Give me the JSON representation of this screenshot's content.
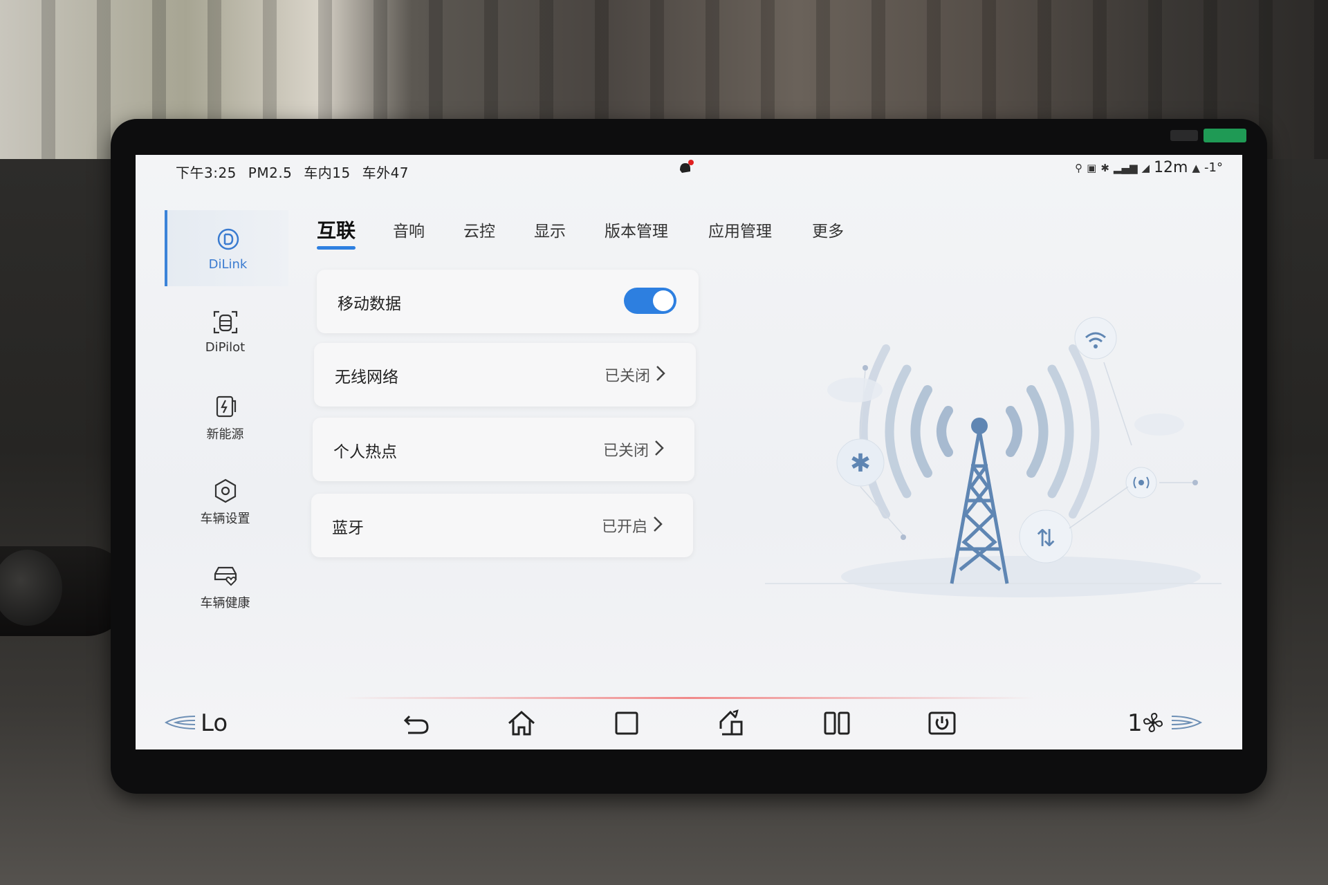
{
  "status_bar": {
    "time": "下午3:25",
    "pm25": "PM2.5",
    "indoor": "车内15",
    "outdoor": "车外47",
    "right_text": "12m",
    "right_temp": "-1°"
  },
  "sidebar": {
    "items": [
      {
        "label": "DiLink",
        "icon": "dilink-icon",
        "active": true
      },
      {
        "label": "DiPilot",
        "icon": "dipilot-icon",
        "active": false
      },
      {
        "label": "新能源",
        "icon": "charging-icon",
        "active": false
      },
      {
        "label": "车辆设置",
        "icon": "hexagon-settings-icon",
        "active": false
      },
      {
        "label": "车辆健康",
        "icon": "car-health-icon",
        "active": false
      }
    ]
  },
  "tabs": [
    {
      "label": "互联",
      "active": true
    },
    {
      "label": "音响",
      "active": false
    },
    {
      "label": "云控",
      "active": false
    },
    {
      "label": "显示",
      "active": false
    },
    {
      "label": "版本管理",
      "active": false
    },
    {
      "label": "应用管理",
      "active": false
    },
    {
      "label": "更多",
      "active": false
    }
  ],
  "settings": {
    "mobile_data": {
      "title": "移动数据",
      "enabled": true
    },
    "wifi": {
      "title": "无线网络",
      "status": "已关闭"
    },
    "hotspot": {
      "title": "个人热点",
      "status": "已关闭"
    },
    "bluetooth": {
      "title": "蓝牙",
      "status": "已开启"
    }
  },
  "bottom_bar": {
    "left_temp": "Lo",
    "right_fan": "1"
  },
  "colors": {
    "accent": "#2d7fe0",
    "indicator_red": "#e02020"
  }
}
